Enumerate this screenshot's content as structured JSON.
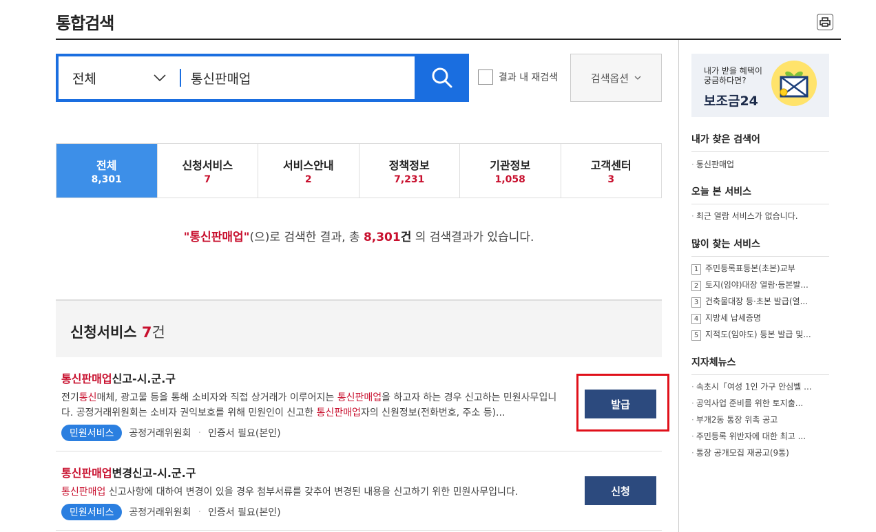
{
  "page": {
    "title": "통합검색"
  },
  "search": {
    "category": "전체",
    "query": "통신판매업",
    "recheck_label": "결과 내 재검색",
    "options_label": "검색옵션"
  },
  "tabs": [
    {
      "label": "전체",
      "count": "8,301"
    },
    {
      "label": "신청서비스",
      "count": "7"
    },
    {
      "label": "서비스안내",
      "count": "2"
    },
    {
      "label": "정책정보",
      "count": "7,231"
    },
    {
      "label": "기관정보",
      "count": "1,058"
    },
    {
      "label": "고객센터",
      "count": "3"
    }
  ],
  "summary": {
    "q": "\"통신판매업\"",
    "part1": "(으)로 검색한 결과, 총 ",
    "total": "8,301",
    "unit": "건",
    "part2": " 의 검색결과가 있습니다."
  },
  "section": {
    "title": "신청서비스",
    "count": "7",
    "unit": "건"
  },
  "results": [
    {
      "title_hl": "통신판매업",
      "title_rest": "신고-시.군.구",
      "desc": [
        {
          "t": "전기",
          "h": false
        },
        {
          "t": "통신",
          "h": true
        },
        {
          "t": "매체, 광고물 등을 통해 소비자와 직접 상거래가 이루어지는 ",
          "h": false
        },
        {
          "t": "통신판매업",
          "h": true
        },
        {
          "t": "을 하고자 하는 경우 신고하는 민원사무입니다. 공정거래위원회는 소비자 권익보호를 위해 민원인이 신고한 ",
          "h": false
        },
        {
          "t": "통신판매업",
          "h": true
        },
        {
          "t": "자의 신원정보(전화번호, 주소 등)...",
          "h": false
        }
      ],
      "tag": "민원서비스",
      "org": "공정거래위원회",
      "cert": "인증서 필요(본인)",
      "button": "발급"
    },
    {
      "title_hl": "통신판매업",
      "title_rest": "변경신고-시.군.구",
      "desc": [
        {
          "t": "통신판매업",
          "h": true
        },
        {
          "t": " 신고사항에 대하여 변경이 있을 경우 첨부서류를 갖추어 변경된 내용을 신고하기 위한 민원사무입니다.",
          "h": false
        }
      ],
      "tag": "민원서비스",
      "org": "공정거래위원회",
      "cert": "인증서 필요(본인)",
      "button": "신청"
    }
  ],
  "sidebar": {
    "banner": {
      "line1": "내가 받을 혜택이",
      "line2": "궁금하다면?",
      "brand": "보조금24"
    },
    "my_searches": {
      "heading": "내가 찾은 검색어",
      "items": [
        "통신판매업"
      ]
    },
    "today_viewed": {
      "heading": "오늘 본 서비스",
      "items": [
        "최근 열람 서비스가 없습니다."
      ]
    },
    "popular": {
      "heading": "많이 찾는 서비스",
      "items": [
        {
          "rank": "1",
          "label": "주민등록표등본(초본)교부"
        },
        {
          "rank": "2",
          "label": "토지(임야)대장 열람·등본발..."
        },
        {
          "rank": "3",
          "label": "건축물대장 등·초본 발급(열..."
        },
        {
          "rank": "4",
          "label": "지방세 납세증명"
        },
        {
          "rank": "5",
          "label": "지적도(임야도) 등본 발급 및..."
        }
      ]
    },
    "local_news": {
      "heading": "지자체뉴스",
      "items": [
        "속초시「여성 1인 가구 안심벨 ...",
        "공익사업 준비를 위한 토지출...",
        "부개2동 통장 위촉 공고",
        "주민등록 위반자에 대한 최고 ...",
        "통장 공개모집 재공고(9통)"
      ]
    }
  }
}
